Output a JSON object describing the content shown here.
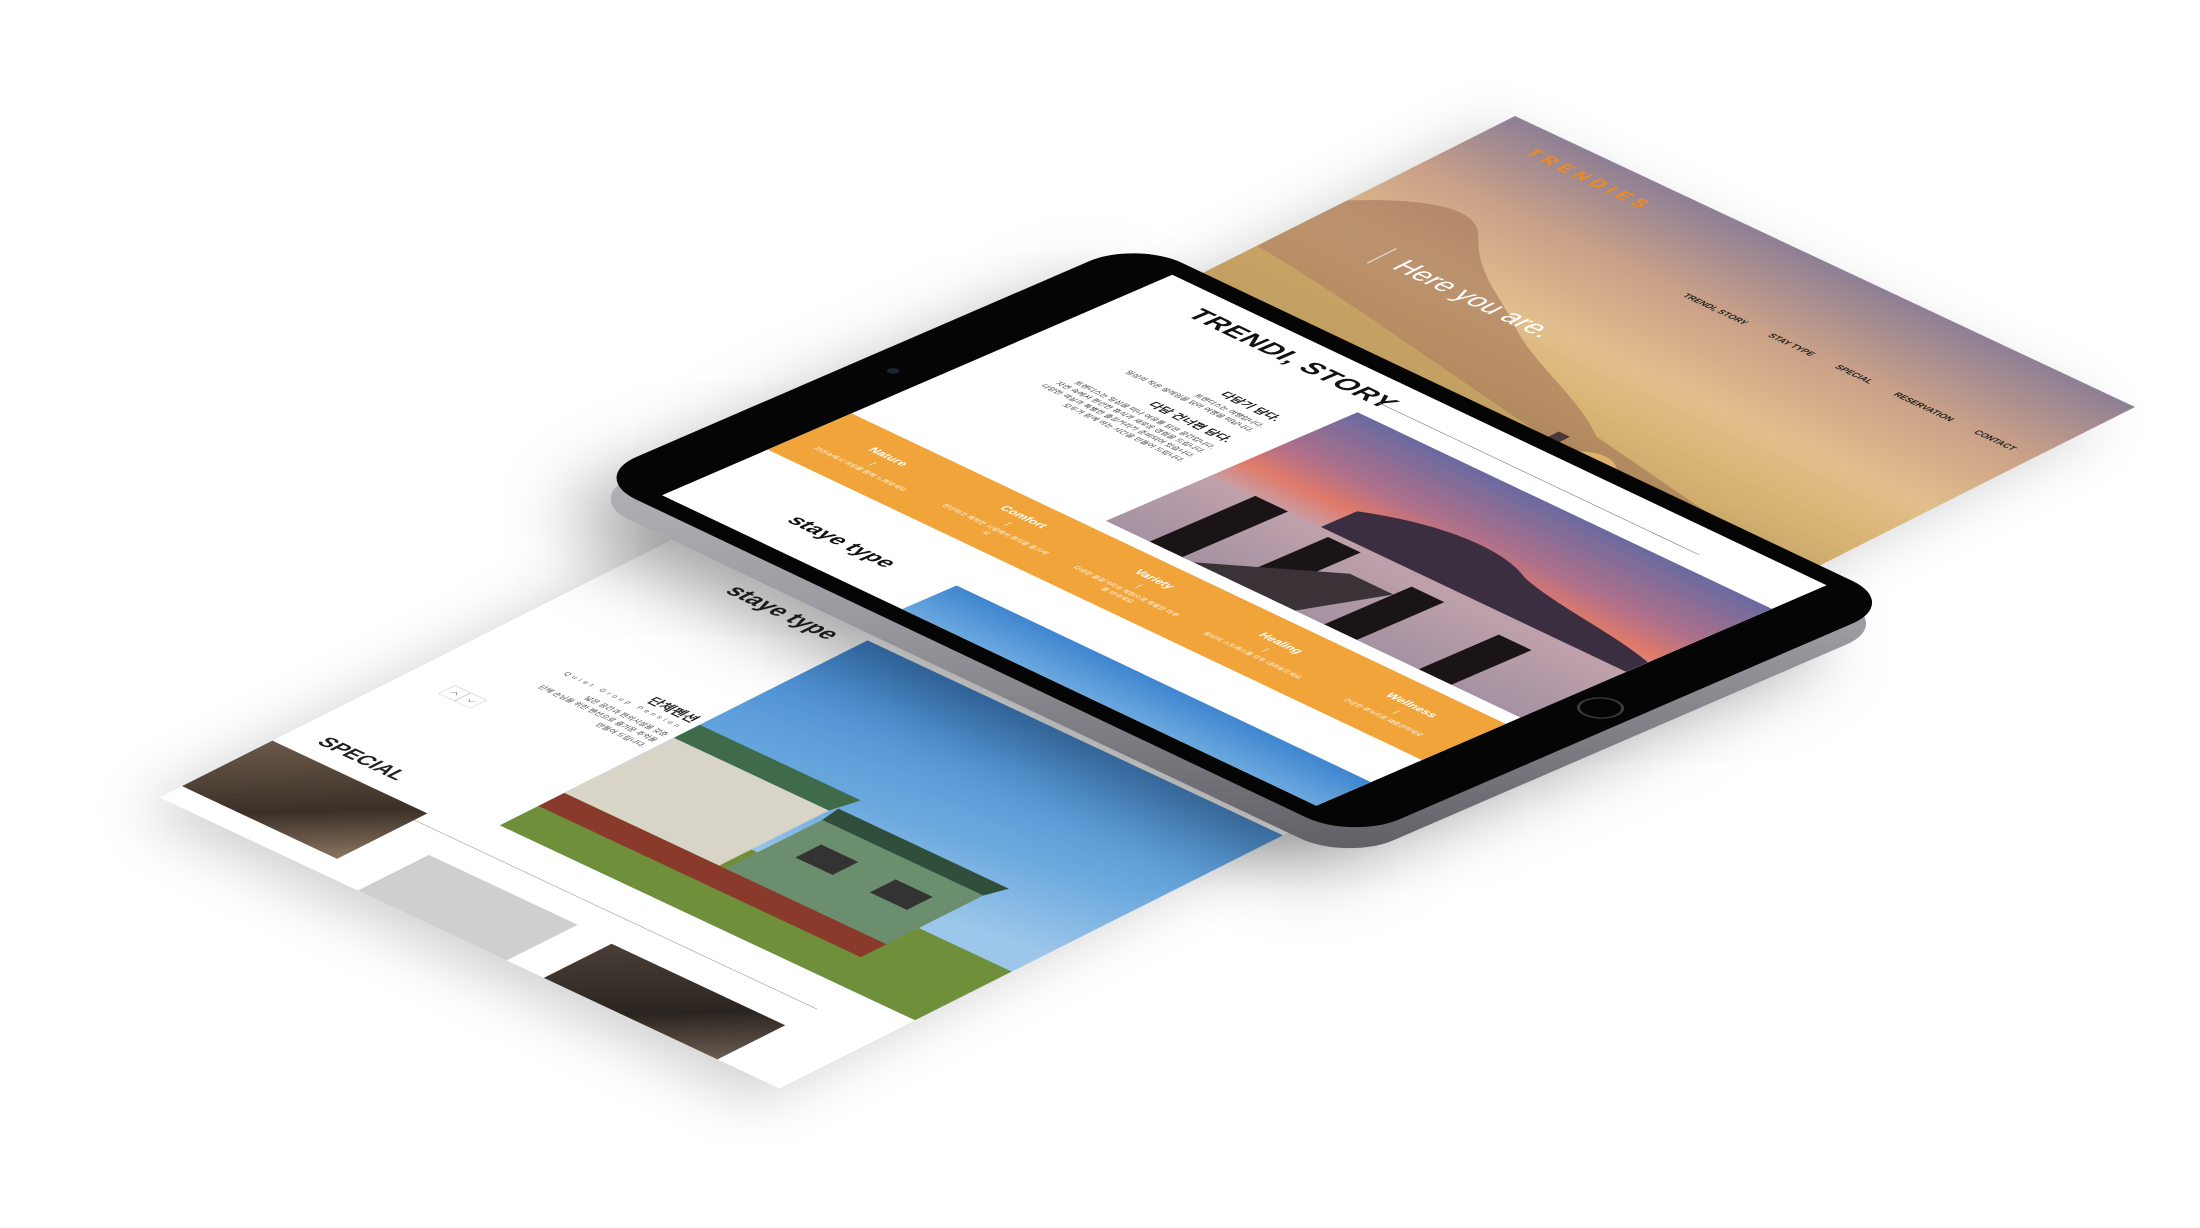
{
  "site": {
    "logo": "TRENDIES",
    "nav": [
      "TRENDI, STORY",
      "STAY TYPE",
      "SPECIAL",
      "RESERVATION",
      "CONTACT"
    ],
    "hero_tagline": "Here you are."
  },
  "story": {
    "title": "TRENDI, STORY",
    "blocks": [
      {
        "heading": "다담기 담다.",
        "lines": [
          "트렌디스는 여행입니다.",
          "일상의 작은 설레임을 담아 여행을 떠납니다."
        ]
      },
      {
        "heading": "다담 건너편 담다.",
        "lines": [
          "트렌디스는 일상을 떠나 여유를 담은 공간입니다.",
          "자연 속에서 편안한 휴식과 새로운 경험을 드립니다.",
          "다양한 객실과 특별한 즐길거리가 준비되어 있습니다.",
          "모두가 함께 하는 시간을 만들어 드립니다."
        ]
      }
    ]
  },
  "features": [
    {
      "title": "Nature",
      "desc": "자연속에서 여유를 함께 느껴보세요"
    },
    {
      "title": "Comfort",
      "desc": "편안하고 쾌적한 시설에서 휴식을 즐기세요"
    },
    {
      "title": "Variety",
      "desc": "다양한 즐길거리와 체험으로 특별한 하루를 보내세요"
    },
    {
      "title": "Healing",
      "desc": "일상의 스트레스를 모두 내려놓으세요"
    },
    {
      "title": "Wellness",
      "desc": "건강한 휴식으로 재충전하세요"
    }
  ],
  "stay_type": {
    "title": "staye type",
    "item_title": "단체펜션",
    "item_subtitle": "Quiet Group Pension",
    "item_desc": [
      "넓은 공간과 편의시설을 갖춘",
      "단체 손님을 위한 펜션으로 즐거운 추억을",
      "만들어 드립니다."
    ]
  },
  "special": {
    "title": "SPECIAL"
  },
  "colors": {
    "brand": "#f08a1c",
    "band": "#f0a43a",
    "bezel": "#050505"
  }
}
